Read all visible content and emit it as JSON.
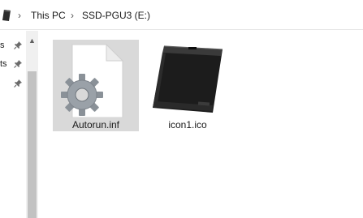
{
  "address_bar": {
    "breadcrumbs": [
      "This PC",
      "SSD-PGU3 (E:)"
    ],
    "drive_icon": "portable-drive-icon",
    "separator_icon": "chevron-right-icon"
  },
  "nav_pane": {
    "items": [
      {
        "label": "s",
        "pin_icon": "pin-icon"
      },
      {
        "label": "ts",
        "pin_icon": "pin-icon"
      },
      {
        "label": "",
        "pin_icon": "pin-icon"
      }
    ],
    "scroll_up_icon": "chevron-up-icon"
  },
  "files": [
    {
      "name": "Autorun.inf",
      "icon": "settings-file-icon",
      "selected": true
    },
    {
      "name": "icon1.ico",
      "icon": "portable-drive-icon",
      "selected": false
    }
  ],
  "colors": {
    "selection": "#d9d9d9",
    "scroll_thumb": "#c2c2c2",
    "scroll_track": "#f0f0f0"
  }
}
